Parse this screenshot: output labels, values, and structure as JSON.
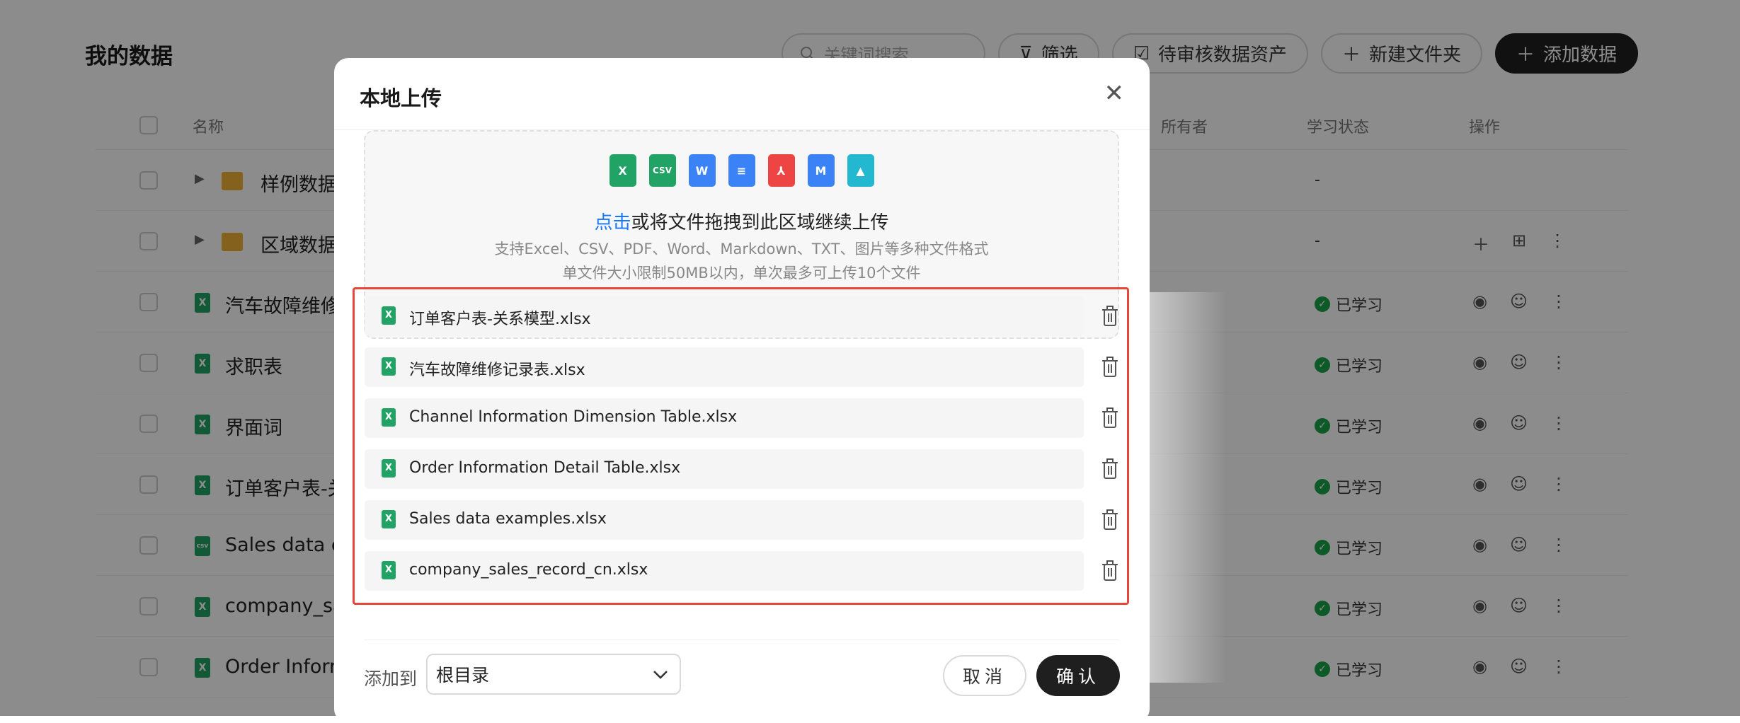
{
  "page": {
    "title": "我的数据",
    "search_placeholder": "关键词搜索",
    "filter_label": "筛选",
    "pending_label": "待审核数据资产",
    "new_folder_label": "新建文件夹",
    "add_data_label": "添加数据",
    "columns": {
      "name": "名称",
      "owner": "所有者",
      "study_status": "学习状态",
      "actions": "操作"
    },
    "rows": [
      {
        "name": "样例数据",
        "kind": "folder",
        "status": "-"
      },
      {
        "name": "区域数据",
        "kind": "folder",
        "status": "-"
      },
      {
        "name": "汽车故障维修",
        "kind": "xlsx",
        "status": "已学习"
      },
      {
        "name": "求职表",
        "kind": "xlsx",
        "status": "已学习"
      },
      {
        "name": "界面词",
        "kind": "xlsx",
        "status": "已学习"
      },
      {
        "name": "订单客户表-关",
        "kind": "xlsx",
        "status": "已学习"
      },
      {
        "name": "Sales data ex",
        "kind": "csv",
        "status": "已学习"
      },
      {
        "name": "company_sale",
        "kind": "xlsx",
        "status": "已学习"
      },
      {
        "name": "Order Informa",
        "kind": "xlsx",
        "status": "已学习"
      }
    ]
  },
  "modal": {
    "title": "本地上传",
    "file_type_icons": [
      {
        "name": "excel-icon",
        "text": "X",
        "color": "#21a366"
      },
      {
        "name": "csv-icon",
        "text": "CSV",
        "color": "#21a366"
      },
      {
        "name": "word-icon",
        "text": "W",
        "color": "#3b82f6"
      },
      {
        "name": "text-doc-icon",
        "text": "≡",
        "color": "#3b82f6"
      },
      {
        "name": "pdf-icon",
        "text": "⅄",
        "color": "#ef4444"
      },
      {
        "name": "markdown-icon",
        "text": "M",
        "color": "#3b82f6"
      },
      {
        "name": "image-icon",
        "text": "▲",
        "color": "#22b8cf"
      }
    ],
    "dropzone": {
      "link_text": "点击",
      "main_text": "或将文件拖拽到此区域继续上传",
      "formats_text": "支持Excel、CSV、PDF、Word、Markdown、TXT、图片等多种文件格式",
      "limit_text": "单文件大小限制50MB以内，单次最多可上传10个文件"
    },
    "files": [
      "订单客户表-关系模型.xlsx",
      "汽车故障维修记录表.xlsx",
      "Channel Information Dimension Table.xlsx",
      "Order Information Detail Table.xlsx",
      "Sales data examples.xlsx",
      "company_sales_record_cn.xlsx"
    ],
    "add_to_label": "添加到",
    "add_to_value": "根目录",
    "cancel_label": "取消",
    "confirm_label": "确认"
  }
}
